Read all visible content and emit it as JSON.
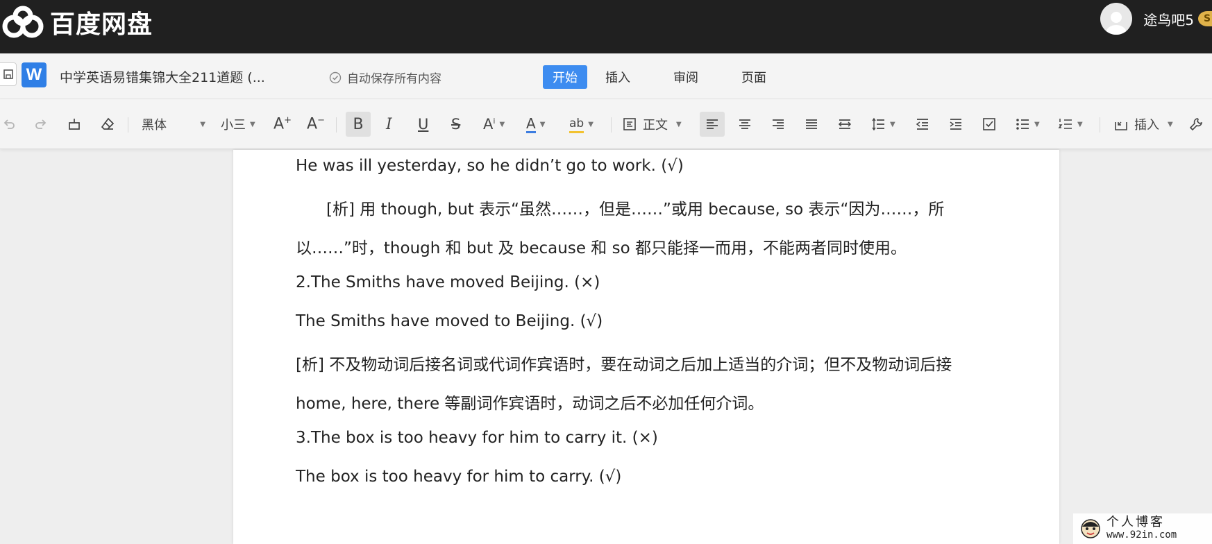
{
  "topbar": {
    "logo_text": "百度网盘",
    "username": "途鸟吧5",
    "vip_badge": "S"
  },
  "docbar": {
    "doc_title": "中学英语易错集锦大全211道题 (...",
    "autosave_text": "自动保存所有内容",
    "tabs": [
      {
        "label": "开始",
        "active": true
      },
      {
        "label": "插入",
        "active": false
      },
      {
        "label": "审阅",
        "active": false
      },
      {
        "label": "页面",
        "active": false
      }
    ]
  },
  "toolbar": {
    "font_family": "黑体",
    "font_size": "小三",
    "paragraph_style": "正文",
    "insert_label": "插入",
    "accent_underline": "#3d7de0",
    "highlight_underline": "#f2c230"
  },
  "content": {
    "lines": [
      "He was ill yesterday, so he didn’t go to work. (√)",
      "[析]  用 though, but 表示“虽然……，但是……”或用 because, so  表示“因为……，所",
      "以……”时，though 和 but  及 because 和 so  都只能择一而用，不能两者同时使用。",
      "2.The Smiths have moved Beijing. (×)",
      "The Smiths have moved to Beijing. (√)",
      "[析]  不及物动词后接名词或代词作宾语时，要在动词之后加上适当的介词；但不及物动词后接",
      "home, here, there 等副词作宾语时，动词之后不必加任何介词。",
      "3.The box is too heavy for him to carry it. (×)",
      "The box is too heavy for him to carry. (√)"
    ]
  },
  "watermark": {
    "line1": "个人博客",
    "line2": "www.92in.com"
  }
}
